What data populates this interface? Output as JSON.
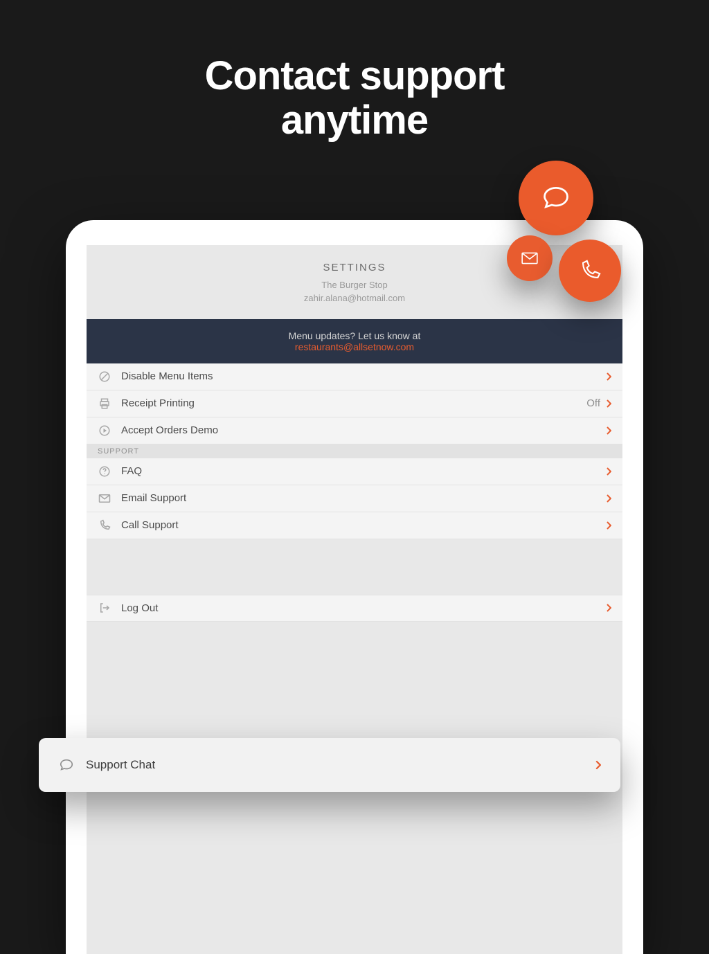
{
  "hero": {
    "line1": "Contact support",
    "line2": "anytime"
  },
  "settings": {
    "title": "SETTINGS",
    "restaurant": "The Burger Stop",
    "account_email": "zahir.alana@hotmail.com"
  },
  "banner": {
    "prefix": "Menu updates? Let us know at",
    "email": "restaurants@allsetnow.com"
  },
  "rows": {
    "disable_menu": "Disable Menu Items",
    "receipt_printing": "Receipt Printing",
    "receipt_printing_value": "Off",
    "accept_orders_demo": "Accept Orders Demo",
    "section_support": "SUPPORT",
    "faq": "FAQ",
    "email_support": "Email Support",
    "call_support": "Call Support",
    "support_chat": "Support Chat",
    "log_out": "Log Out"
  },
  "colors": {
    "accent": "#e85c2f",
    "banner_bg": "#2b3447"
  }
}
